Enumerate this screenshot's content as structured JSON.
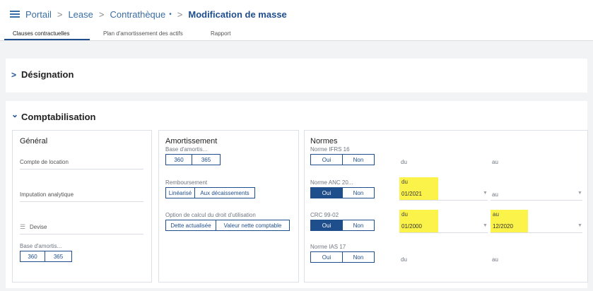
{
  "breadcrumb": [
    "Portail",
    "Lease",
    "Contrathèque",
    "Modification de masse"
  ],
  "breadcrumb_dot": "•",
  "tabs": [
    "Clauses contractuelles",
    "Plan d'amortissement des actifs",
    "Rapport"
  ],
  "sections": {
    "designation": "Désignation",
    "comptabilisation": "Comptabilisation"
  },
  "general": {
    "title": "Général",
    "compte": "Compte de location",
    "imputation": "Imputation analytique",
    "devise": "Devise",
    "base": "Base d'amortis...",
    "base_options": [
      "360",
      "365"
    ]
  },
  "amortissement": {
    "title": "Amortissement",
    "base": "Base d'amortis...",
    "base_options": [
      "360",
      "365"
    ],
    "remboursement": "Remboursement",
    "remb_options": [
      "Linéarisé",
      "Aux décaissements"
    ],
    "option_calc": "Option de calcul du droit d'utilisation",
    "calc_options": [
      "Dette actualisée",
      "Valeur nette comptable"
    ]
  },
  "normes": {
    "title": "Normes",
    "rows": [
      {
        "label": "Norme IFRS 16",
        "oui": "Oui",
        "non": "Non",
        "selected": "",
        "du_label": "du",
        "du_value": "",
        "au_label": "au",
        "au_value": ""
      },
      {
        "label": "Norme ANC 20...",
        "oui": "Oui",
        "non": "Non",
        "selected": "Oui",
        "du_label": "du",
        "du_value": "01/2021",
        "au_label": "au",
        "au_value": ""
      },
      {
        "label": "CRC 99-02",
        "oui": "Oui",
        "non": "Non",
        "selected": "Oui",
        "du_label": "du",
        "du_value": "01/2000",
        "au_label": "au",
        "au_value": "12/2020"
      },
      {
        "label": "Norme IAS 17",
        "oui": "Oui",
        "non": "Non",
        "selected": "",
        "du_label": "du",
        "du_value": "",
        "au_label": "au",
        "au_value": ""
      }
    ]
  },
  "colors": {
    "accent": "#1f4e8c",
    "highlight": "#fbf24a",
    "background": "#f2f3f5"
  }
}
